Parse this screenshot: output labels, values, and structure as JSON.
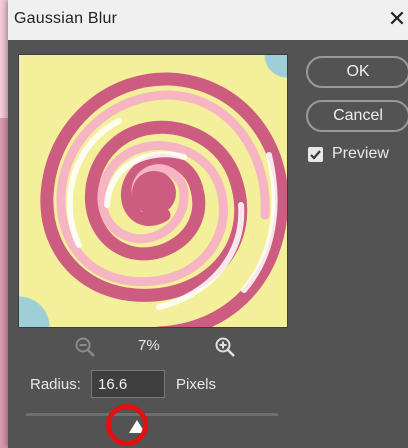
{
  "dialog": {
    "title": "Gaussian Blur",
    "close_symbol": "✕"
  },
  "buttons": {
    "ok_label": "OK",
    "cancel_label": "Cancel"
  },
  "preview_option": {
    "label": "Preview",
    "checked": true
  },
  "zoom": {
    "level": "7%"
  },
  "radius": {
    "label": "Radius:",
    "value": "16.6",
    "units": "Pixels",
    "slider_fraction": 0.42
  },
  "colors": {
    "dialog_bg": "#535353",
    "annotation": "#e31010",
    "swirl_dark": "#cc5d80",
    "swirl_light": "#f6b5c3",
    "swirl_yellow": "#f4ef9b",
    "swirl_blue": "#9fcfd6"
  },
  "icons": {
    "zoom_out": "zoom-out-icon",
    "zoom_in": "zoom-in-icon",
    "close": "close-icon",
    "check": "check-icon",
    "slider": "triangle-thumb-icon"
  }
}
